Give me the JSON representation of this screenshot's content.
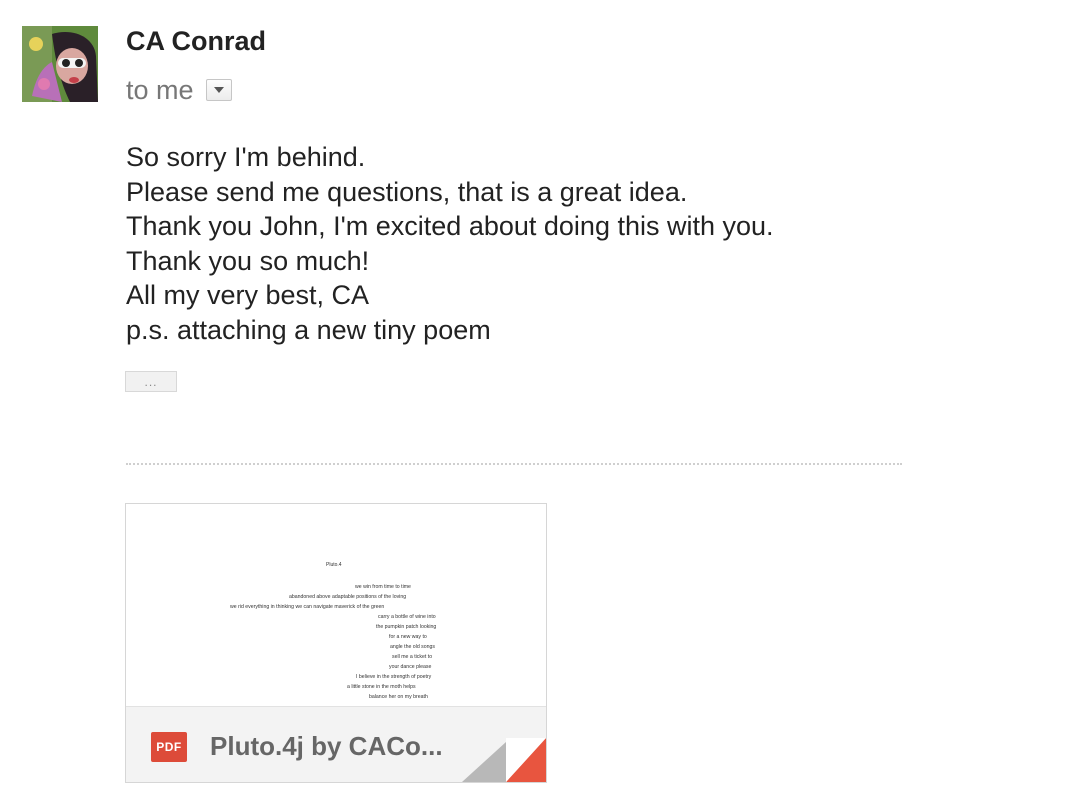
{
  "message": {
    "sender": "CA Conrad",
    "recipient_label": "to me",
    "body_lines": [
      "So sorry I'm behind.",
      "Please send me questions, that is a great idea.",
      "Thank you John, I'm excited about doing this with you.",
      "Thank you so much!",
      "All my very best, CA",
      "p.s. attaching a new tiny poem"
    ],
    "trimmed_content_label": "..."
  },
  "attachment": {
    "file_type_label": "PDF",
    "name": "Pluto.4j by CACo...",
    "preview": {
      "title": "Pluto.4",
      "lines": [
        "we win from time to time",
        "abandoned above adaptable positions of the loving",
        "we rid everything in thinking we can navigate maverick of the green",
        "carry a bottle of wine into",
        "the pumpkin patch looking",
        "for a new        way to",
        "angle the old songs",
        "sell me a ticket to",
        "your dance please",
        "I believe in the strength of poetry",
        "a little stone in the moth helps",
        "balance her on my breath"
      ]
    }
  },
  "icons": {
    "details": "chevron-down-icon",
    "file": "pdf-icon",
    "corner": "page-fold-icon"
  },
  "colors": {
    "pdf_red": "#dd4b39",
    "secondary_text": "#777777"
  }
}
